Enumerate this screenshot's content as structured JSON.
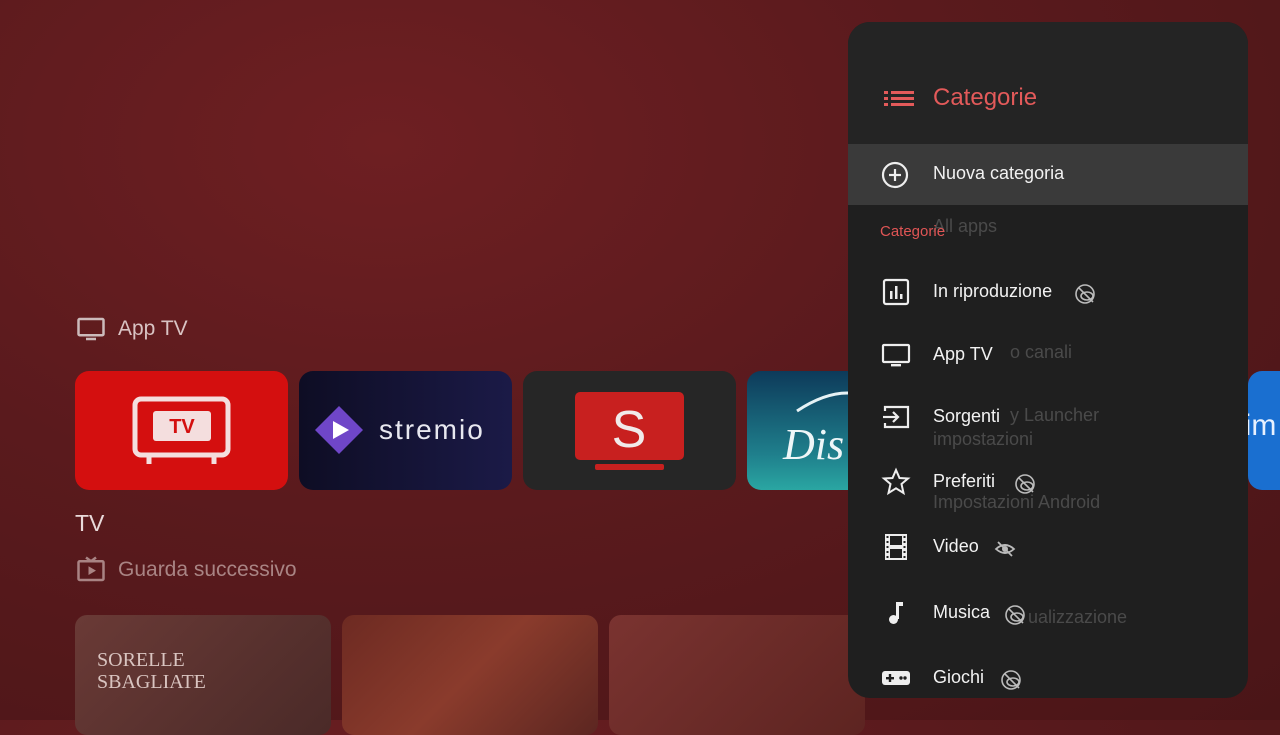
{
  "background": {
    "app_tv_row_title": "App TV",
    "tv_heading": "TV",
    "watch_next_title": "Guarda successivo",
    "apps": [
      {
        "name": "TV",
        "icon": "tv-app-icon"
      },
      {
        "name": "stremio",
        "icon": "stremio-logo"
      },
      {
        "name": "S",
        "icon": "s-app-logo"
      },
      {
        "name": "Dis",
        "icon": "disney-plus-logo"
      },
      {
        "name": "prim",
        "icon": "prime-video-logo"
      }
    ],
    "thumbnails": [
      {
        "title_line1": "SORELLE",
        "title_line2": "SBAGLIATE"
      },
      {
        "title_line1": "",
        "title_line2": ""
      },
      {
        "title_line1": "",
        "title_line2": ""
      }
    ],
    "ghost_menu": [
      "All apps",
      "o canali",
      "y Launcher",
      "impostazioni",
      "Impostazioni Android",
      "ualizzazione"
    ]
  },
  "panel": {
    "title": "Categorie",
    "new_category_label": "Nuova categoria",
    "subheader": "Categorie",
    "items": [
      {
        "label": "In riproduzione",
        "icon": "bar-chart-icon",
        "hidden": true
      },
      {
        "label": "App TV",
        "icon": "tv-icon",
        "hidden": false
      },
      {
        "label": "Sorgenti",
        "icon": "input-icon",
        "hidden": false
      },
      {
        "label": "Preferiti",
        "icon": "star-icon",
        "hidden": true
      },
      {
        "label": "Video",
        "icon": "film-icon",
        "hidden": true
      },
      {
        "label": "Musica",
        "icon": "music-note-icon",
        "hidden": true
      },
      {
        "label": "Giochi",
        "icon": "gamepad-icon",
        "hidden": true
      }
    ]
  },
  "colors": {
    "accent": "#e35a5a",
    "panel_bg": "#1f1f1f",
    "highlight": "#3a3a3a"
  }
}
